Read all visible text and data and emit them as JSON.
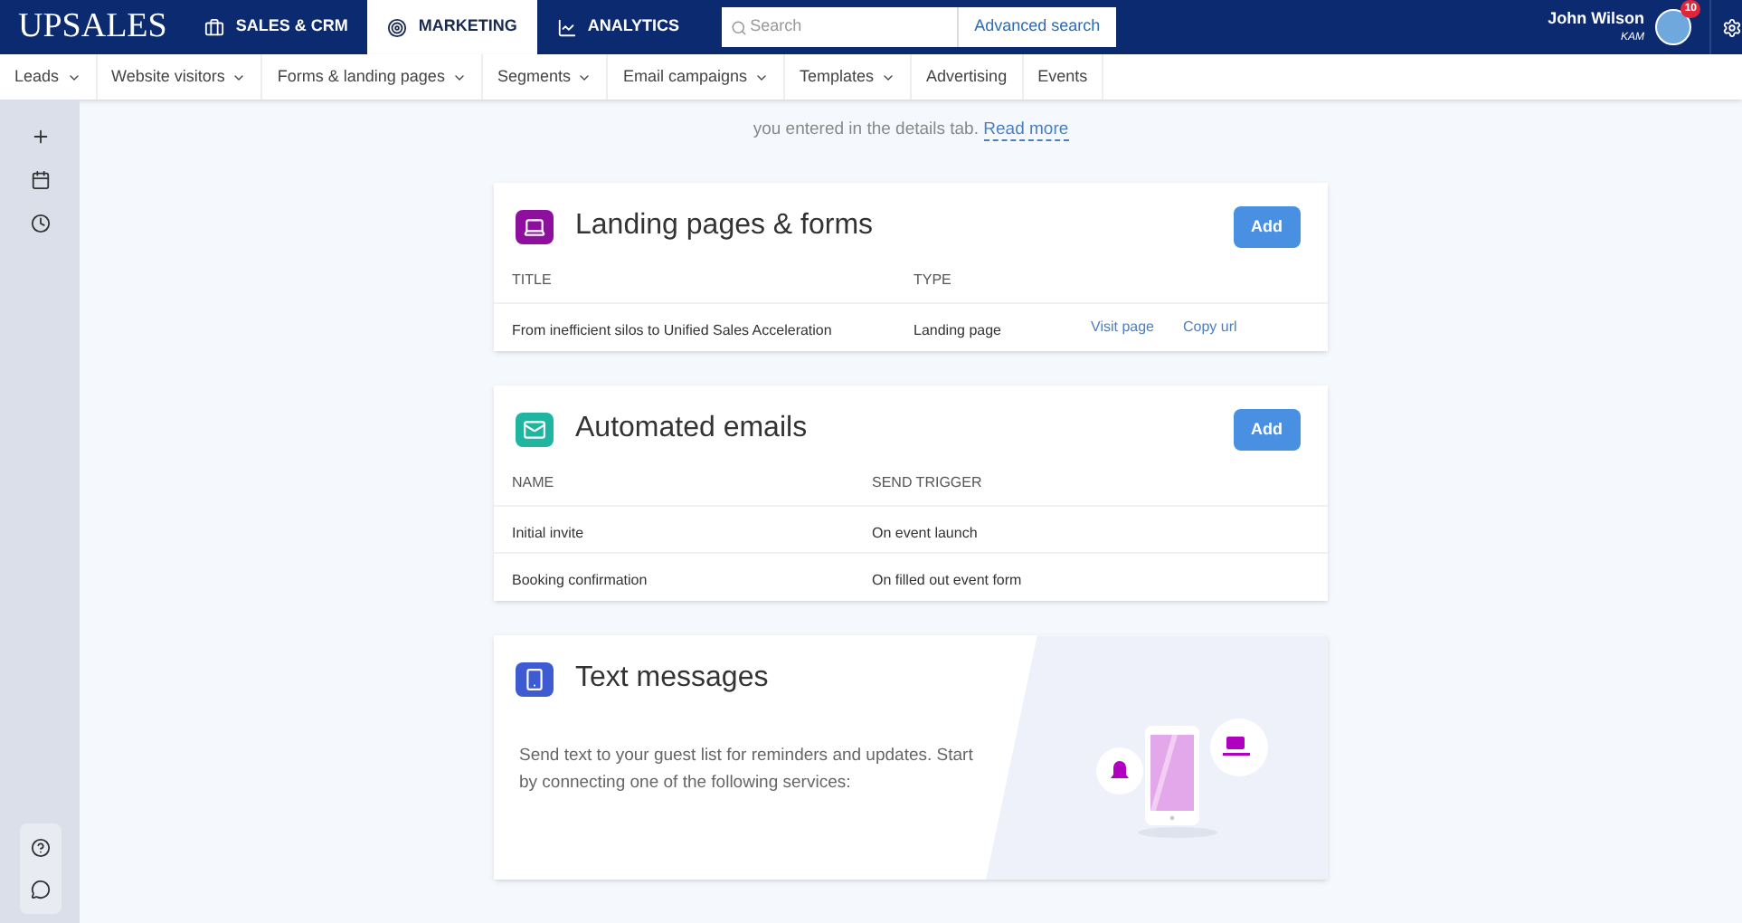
{
  "logo": "UPSALES",
  "main_tabs": [
    {
      "label": "SALES & CRM",
      "selected": false
    },
    {
      "label": "MARKETING",
      "selected": true
    },
    {
      "label": "ANALYTICS",
      "selected": false
    }
  ],
  "search": {
    "placeholder": "Search",
    "advanced": "Advanced search"
  },
  "user": {
    "name": "John Wilson",
    "role": "KAM",
    "notifications": "10"
  },
  "sub_nav": [
    {
      "label": "Leads",
      "dropdown": true
    },
    {
      "label": "Website visitors",
      "dropdown": true
    },
    {
      "label": "Forms & landing pages",
      "dropdown": true
    },
    {
      "label": "Segments",
      "dropdown": true
    },
    {
      "label": "Email campaigns",
      "dropdown": true
    },
    {
      "label": "Templates",
      "dropdown": true
    },
    {
      "label": "Advertising",
      "dropdown": false
    },
    {
      "label": "Events",
      "dropdown": false
    }
  ],
  "intro": {
    "text": "you entered in the details tab.",
    "link": "Read more"
  },
  "cards": [
    {
      "kind": "table",
      "title": "Landing pages & forms",
      "color": "#8e0f9e",
      "button": "Add",
      "columns": [
        "TITLE",
        "TYPE"
      ],
      "rows": [
        {
          "cells": [
            "From inefficient silos to Unified Sales Acceleration",
            "Landing page"
          ],
          "links": [
            "Visit page",
            "Copy url"
          ]
        }
      ]
    },
    {
      "kind": "table",
      "title": "Automated emails",
      "color": "#1fb5a0",
      "button": "Add",
      "columns": [
        "NAME",
        "SEND TRIGGER"
      ],
      "rows": [
        {
          "cells": [
            "Initial invite",
            "On event launch"
          ],
          "links": []
        },
        {
          "cells": [
            "Booking confirmation",
            "On filled out event form"
          ],
          "links": []
        }
      ]
    },
    {
      "kind": "promo",
      "title": "Text messages",
      "color": "#3f5bd1",
      "description": "Send text to your guest list for reminders and updates. Start by connecting one of the following services:"
    }
  ]
}
